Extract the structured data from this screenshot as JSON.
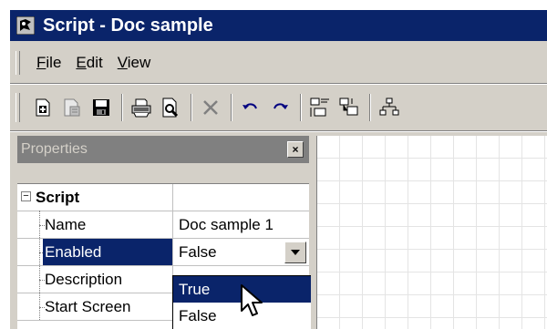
{
  "window": {
    "title": "Script - Doc sample"
  },
  "menu": {
    "items": [
      {
        "accel": "F",
        "rest": "ile"
      },
      {
        "accel": "E",
        "rest": "dit"
      },
      {
        "accel": "V",
        "rest": "iew"
      }
    ]
  },
  "toolbar": {
    "icons": [
      "new-icon",
      "properties-icon",
      "save-icon",
      "print-icon",
      "print-preview-icon",
      "delete-icon",
      "undo-icon",
      "redo-icon",
      "align-icon",
      "group-icon",
      "hierarchy-icon"
    ]
  },
  "properties": {
    "title": "Properties",
    "close_label": "×",
    "section": {
      "label": "Script",
      "toggle": "−"
    },
    "rows": [
      {
        "name": "Name",
        "value": "Doc sample 1"
      },
      {
        "name": "Enabled",
        "value": "False"
      },
      {
        "name": "Description",
        "value": ""
      },
      {
        "name": "Start Screen",
        "value": ""
      }
    ]
  },
  "dropdown": {
    "options": [
      "True",
      "False"
    ],
    "highlighted": "True"
  },
  "colors": {
    "titlebar": "#0a246a",
    "selection": "#0a246a",
    "face": "#d4d0c8"
  }
}
